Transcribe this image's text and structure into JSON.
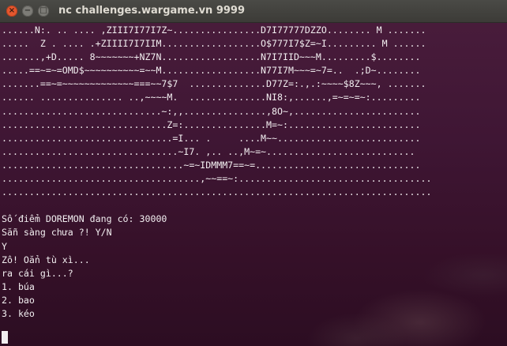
{
  "window": {
    "title": "nc challenges.wargame.vn 9999"
  },
  "titlebar_buttons": {
    "close": "×",
    "minimize": "−",
    "maximize": "□"
  },
  "terminal": {
    "ascii_art": [
      "......N:. .. .... ,ZIII7I77I7Z~................D7I77777DZZO........ M .......",
      ".....  Z . .... .+ZIIII7I7IIM..................O$777I7$Z=~I......... M ......",
      ".......,+D..... 8~~~~~~~+NZ7N..................N7I7IID~~~M.........$........",
      ".....==~=~=OMD$~~~~~~~~~~=~~M..................N77I7M~~~=~7=..  .;D~........",
      ".......==~=~~~~~~~~~~~~~===~~7$7  ..............D77Z=:.,.:~~~~$8Z~~~, .......",
      "...... ............... ..,~~~~M.  ..............NI8:,......,=~=~=~:.........",
      ".............................~:,,...............,8O~,.......................",
      "..............................Z=:...............M=~:........................",
      "...............................=I... .     ....M~~..........................",
      "................................~I7. ,.. ..,M~=~...........................",
      ".................................~=~IDMMM7==~=..............................",
      "....................................,~~==~:...................................",
      ".............................................................................."
    ],
    "score_line": "Số điểm DOREMON đang có: 30000",
    "ready_prompt": "Sẵn sàng chưa ?! Y/N",
    "user_input": "Y",
    "chant": "Zô! Oẳn tù xì...",
    "choose_prompt": "ra cái gì...?",
    "options": [
      "1. búa",
      "2. bao",
      "3. kéo"
    ]
  }
}
